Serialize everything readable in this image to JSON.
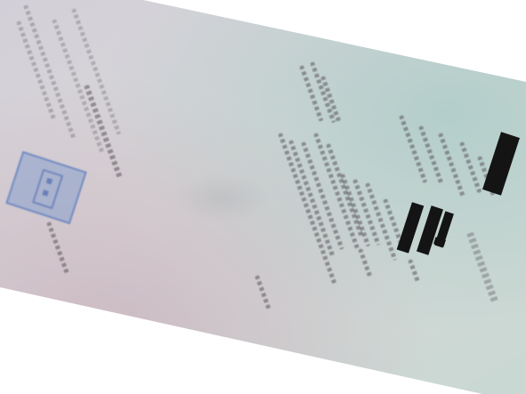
{
  "document": {
    "title": "",
    "header_lines": [
      "",
      "",
      "",
      "",
      "",
      "",
      "",
      ""
    ],
    "body_lines": [
      "",
      "",
      "",
      "",
      "",
      "",
      "",
      "",
      "",
      "",
      "",
      ""
    ],
    "footer_lines": [
      "",
      "",
      "",
      "",
      ""
    ],
    "issuer": "",
    "seal": {
      "text": "",
      "color": "#7896cd"
    }
  },
  "redactions": [
    "name",
    "id-number",
    "signature",
    "number"
  ],
  "colors": {
    "paper": "#d6d6da",
    "text": "#5a5560",
    "redaction": "#141414",
    "seal": "#7896cd"
  }
}
